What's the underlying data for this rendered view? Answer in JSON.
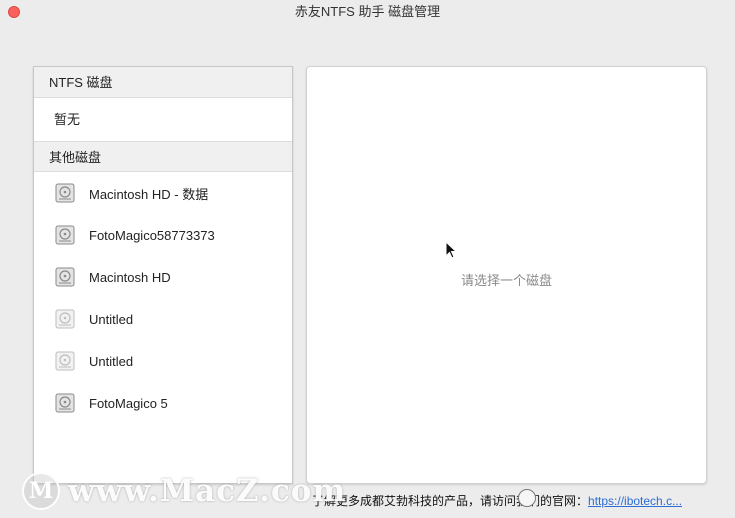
{
  "window": {
    "title": "赤友NTFS 助手 磁盘管理"
  },
  "sidebar": {
    "ntfs_header": "NTFS 磁盘",
    "ntfs_empty": "暂无",
    "other_header": "其他磁盘",
    "other_disks": [
      {
        "label": "Macintosh HD - 数据",
        "icon": "hard-disk-icon",
        "dimmed": false
      },
      {
        "label": "FotoMagico58773373",
        "icon": "hard-disk-icon",
        "dimmed": false
      },
      {
        "label": "Macintosh HD",
        "icon": "hard-disk-icon",
        "dimmed": false
      },
      {
        "label": "Untitled",
        "icon": "hard-disk-icon",
        "dimmed": true
      },
      {
        "label": "Untitled",
        "icon": "hard-disk-icon",
        "dimmed": true
      },
      {
        "label": "FotoMagico 5",
        "icon": "hard-disk-icon",
        "dimmed": false
      }
    ]
  },
  "detail": {
    "placeholder": "请选择一个磁盘"
  },
  "footer": {
    "text": "了解更多成都艾勃科技的产品，请访问我们的官网：",
    "link": "https://ibotech.c..."
  },
  "watermark": {
    "text": "www.MacZ.com",
    "logo_letter": "M"
  },
  "colors": {
    "close_button": "#fc605c",
    "link": "#2b6fd6",
    "background": "#ececec"
  }
}
